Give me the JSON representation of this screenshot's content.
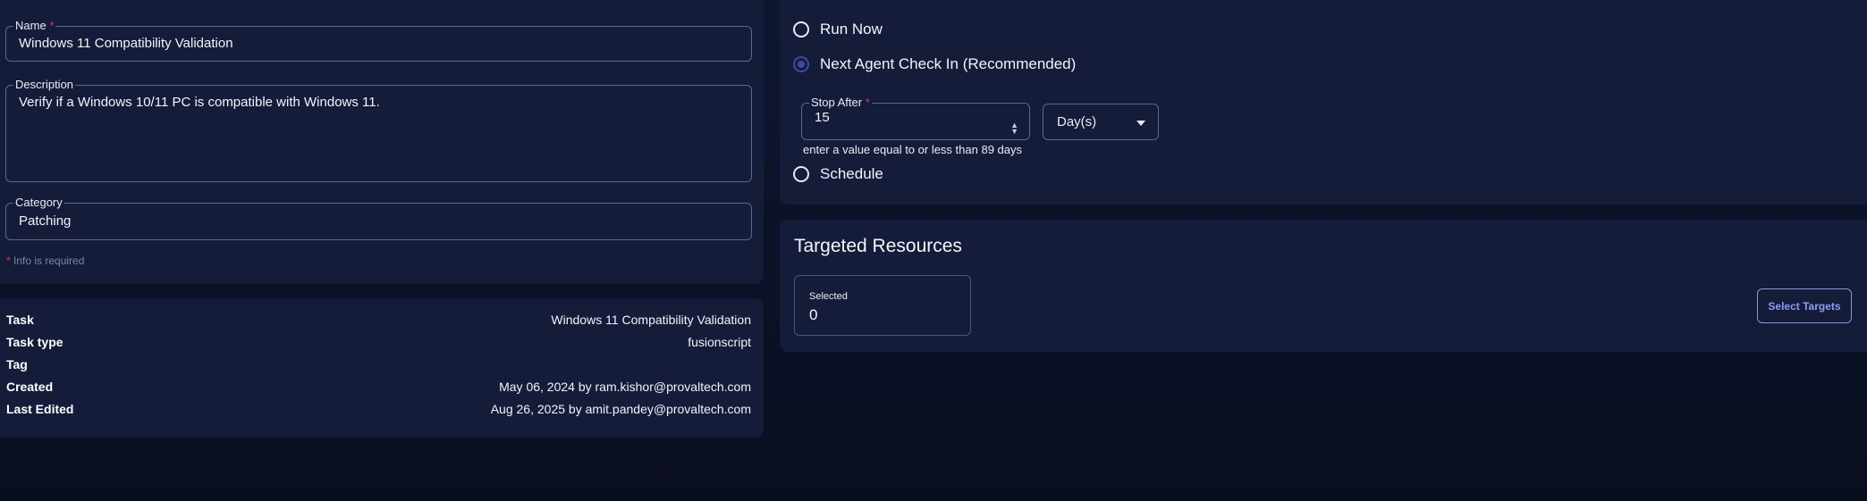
{
  "form": {
    "name_label": "Name",
    "name_value": "Windows 11 Compatibility Validation",
    "description_label": "Description",
    "description_value": "Verify if a Windows 10/11 PC is compatible with Windows 11.",
    "category_label": "Category",
    "category_value": "Patching",
    "required_marker": "*",
    "required_note": "Info is required"
  },
  "details": {
    "rows": [
      {
        "key": "Task",
        "value": "Windows 11 Compatibility Validation"
      },
      {
        "key": "Task type",
        "value": "fusionscript"
      },
      {
        "key": "Tag",
        "value": ""
      },
      {
        "key": "Created",
        "value": "May 06, 2024 by ram.kishor@provaltech.com"
      },
      {
        "key": "Last Edited",
        "value": "Aug 26, 2025 by amit.pandey@provaltech.com"
      }
    ]
  },
  "schedule": {
    "run_now_label": "Run Now",
    "next_checkin_label": "Next Agent Check In (Recommended)",
    "selected_option": "next_checkin",
    "stop_after_label": "Stop After",
    "stop_after_value": "15",
    "stop_after_unit": "Day(s)",
    "stop_after_hint": "enter a value equal to or less than 89 days",
    "schedule_label": "Schedule"
  },
  "targets": {
    "title": "Targeted Resources",
    "selected_label": "Selected",
    "selected_count": "0",
    "select_button_label": "Select Targets"
  },
  "colors": {
    "card": "#141c3a",
    "required": "#e0354b",
    "accent": "#8f9cf0",
    "border": "#5a6890"
  }
}
